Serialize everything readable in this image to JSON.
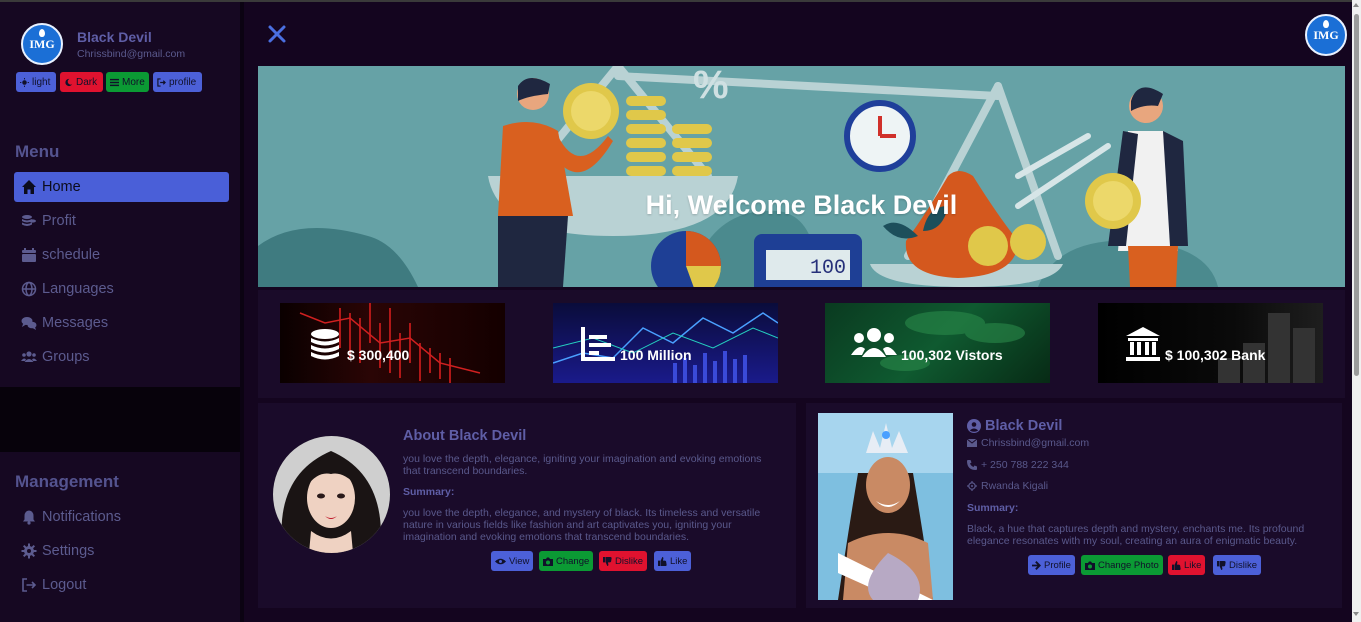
{
  "sidebar": {
    "user_name": "Black Devil",
    "user_email": "Chrissbind@gmail.com",
    "logo_text": "IMG",
    "theme_buttons": {
      "light": "light",
      "dark": "Dark",
      "more": "More",
      "profile": "profile"
    },
    "menu_title": "Menu",
    "menu_items": [
      {
        "label": "Home",
        "icon": "home-icon",
        "active": true
      },
      {
        "label": "Profit",
        "icon": "coins-icon"
      },
      {
        "label": "schedule",
        "icon": "calendar-icon"
      },
      {
        "label": "Languages",
        "icon": "globe-icon"
      },
      {
        "label": "Messages",
        "icon": "comments-icon"
      },
      {
        "label": "Groups",
        "icon": "users-icon"
      }
    ],
    "management_title": "Management",
    "management_items": [
      {
        "label": "Notifications",
        "icon": "bell-icon"
      },
      {
        "label": "Settings",
        "icon": "gear-icon"
      },
      {
        "label": "Logout",
        "icon": "logout-icon"
      }
    ]
  },
  "header": {
    "corner_logo_text": "IMG"
  },
  "banner": {
    "welcome": "Hi, Welcome Black Devil",
    "calculator_display": "100"
  },
  "stats": [
    {
      "value": "$ 300,400",
      "icon": "coins-stack-icon"
    },
    {
      "value": "100 Million",
      "icon": "chart-icon"
    },
    {
      "value": "100,302 Vistors",
      "icon": "users-icon"
    },
    {
      "value": "$ 100,302 Bank",
      "icon": "bank-icon"
    }
  ],
  "about": {
    "title": "About Black Devil",
    "intro": "you love the depth, elegance, igniting your imagination and evoking emotions that transcend boundaries.",
    "summary_label": "Summary:",
    "summary": "you love the depth, elegance, and mystery of black. Its timeless and versatile nature in various fields like fashion and art captivates you, igniting your imagination and evoking emotions that transcend boundaries.",
    "buttons": {
      "view": "View",
      "change": "Change",
      "dislike": "Dislike",
      "like": "Like"
    }
  },
  "profile": {
    "name": "Black Devil",
    "email": "Chrissbind@gmail.com",
    "phone": "+ 250 788 222 344",
    "location": "Rwanda Kigali",
    "summary_label": "Summary:",
    "summary": "Black, a hue that captures depth and mystery, enchants me. Its profound elegance resonates with my soul, creating an aura of enigmatic beauty.",
    "buttons": {
      "profile": "Profile",
      "change_photo": "Change Photo",
      "like": "Like",
      "dislike": "Dislike"
    }
  },
  "colors": {
    "accent": "#4a5fd8",
    "danger": "#e0122f",
    "success": "#0b9a34",
    "background": "#14051f"
  }
}
